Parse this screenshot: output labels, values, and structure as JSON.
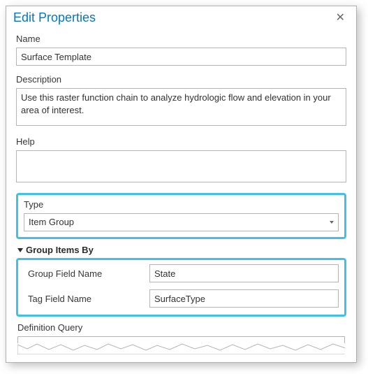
{
  "dialog": {
    "title": "Edit Properties"
  },
  "fields": {
    "name": {
      "label": "Name",
      "value": "Surface Template"
    },
    "description": {
      "label": "Description",
      "value": "Use this raster function chain to analyze hydrologic flow and elevation in your area of interest."
    },
    "help": {
      "label": "Help",
      "value": ""
    },
    "type": {
      "label": "Type",
      "value": "Item Group"
    }
  },
  "groupItemsBy": {
    "header": "Group Items By",
    "groupField": {
      "label": "Group Field Name",
      "value": "State"
    },
    "tagField": {
      "label": "Tag Field Name",
      "value": "SurfaceType"
    }
  },
  "definitionQuery": {
    "label": "Definition Query"
  }
}
